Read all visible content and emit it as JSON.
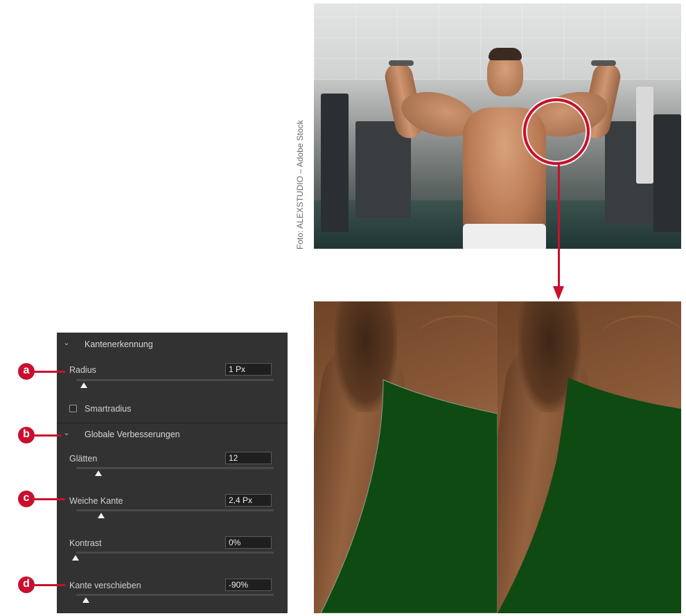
{
  "panel": {
    "sections": {
      "edge_detection": {
        "title": "Kantenerkennung"
      },
      "global_refinements": {
        "title": "Globale Verbesserungen"
      }
    },
    "controls": {
      "radius": {
        "label": "Radius",
        "value": "1 Px",
        "slider_fraction": 0.05
      },
      "smart_radius": {
        "label": "Smartradius",
        "checked": false
      },
      "smooth": {
        "label": "Glätten",
        "value": "12",
        "slider_fraction": 0.12
      },
      "feather": {
        "label": "Weiche Kante",
        "value": "2,4 Px",
        "slider_fraction": 0.13
      },
      "contrast": {
        "label": "Kontrast",
        "value": "0%",
        "slider_fraction": 0.0
      },
      "shift_edge": {
        "label": "Kante verschieben",
        "value": "-90%",
        "slider_fraction": 0.05
      }
    }
  },
  "markers": {
    "a": "a",
    "b": "b",
    "c": "c",
    "d": "d"
  },
  "photo": {
    "credit": "Foto: ALEXSTUDIO – Adobe Stock"
  },
  "colors": {
    "accent": "#c8102e",
    "panel_bg": "#323232",
    "mask_green": "#0f4a12"
  }
}
